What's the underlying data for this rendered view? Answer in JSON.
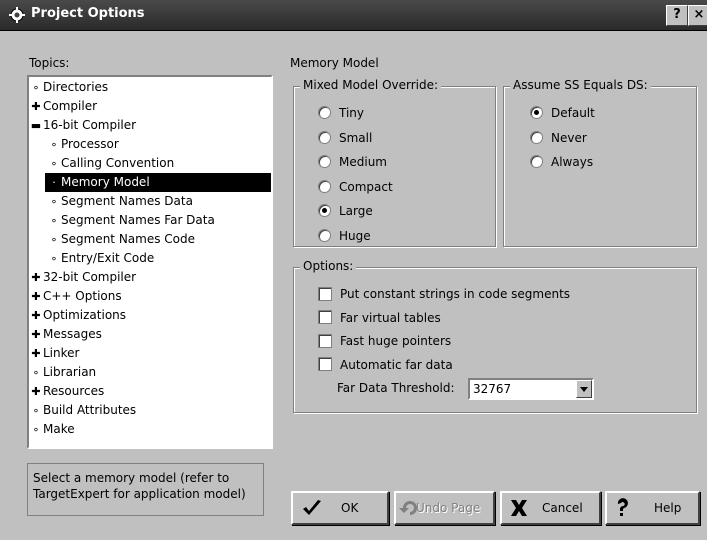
{
  "window": {
    "title": "Project Options",
    "help_button": "?",
    "close_button": "×"
  },
  "topics": {
    "label": "Topics:",
    "items": [
      {
        "glyph": "∘",
        "text": "Directories",
        "indent": 0
      },
      {
        "glyph": "✚",
        "text": "Compiler",
        "indent": 0
      },
      {
        "glyph": "▬",
        "text": "16-bit Compiler",
        "indent": 0
      },
      {
        "glyph": "∘",
        "text": "Processor",
        "indent": 1
      },
      {
        "glyph": "∘",
        "text": "Calling Convention",
        "indent": 1
      },
      {
        "glyph": "·",
        "text": "Memory Model",
        "indent": 1,
        "selected": true
      },
      {
        "glyph": "∘",
        "text": "Segment Names Data",
        "indent": 1
      },
      {
        "glyph": "∘",
        "text": "Segment Names Far Data",
        "indent": 1
      },
      {
        "glyph": "∘",
        "text": "Segment Names Code",
        "indent": 1
      },
      {
        "glyph": "∘",
        "text": "Entry/Exit Code",
        "indent": 1
      },
      {
        "glyph": "✚",
        "text": "32-bit Compiler",
        "indent": 0
      },
      {
        "glyph": "✚",
        "text": "C++ Options",
        "indent": 0
      },
      {
        "glyph": "✚",
        "text": "Optimizations",
        "indent": 0
      },
      {
        "glyph": "✚",
        "text": "Messages",
        "indent": 0
      },
      {
        "glyph": "✚",
        "text": "Linker",
        "indent": 0
      },
      {
        "glyph": "∘",
        "text": "Librarian",
        "indent": 0
      },
      {
        "glyph": "✚",
        "text": "Resources",
        "indent": 0
      },
      {
        "glyph": "∘",
        "text": "Build Attributes",
        "indent": 0
      },
      {
        "glyph": "∘",
        "text": "Make",
        "indent": 0
      }
    ]
  },
  "status_text": "Select a memory model (refer to TargetExpert for application model)",
  "panel": {
    "title": "Memory Model",
    "mixed_model": {
      "title": "Mixed Model Override:",
      "options": [
        "Tiny",
        "Small",
        "Medium",
        "Compact",
        "Large",
        "Huge"
      ],
      "selected": "Large"
    },
    "assume_ss": {
      "title": "Assume SS Equals DS:",
      "options": [
        "Default",
        "Never",
        "Always"
      ],
      "selected": "Default"
    },
    "options_group": {
      "title": "Options:",
      "checkboxes": [
        {
          "label": "Put constant strings in code segments",
          "checked": false
        },
        {
          "label": "Far virtual tables",
          "checked": false
        },
        {
          "label": "Fast huge pointers",
          "checked": false
        },
        {
          "label": "Automatic far data",
          "checked": false
        }
      ],
      "threshold_label": "Far Data Threshold:",
      "threshold_value": "32767"
    }
  },
  "buttons": {
    "ok": "OK",
    "undo": "Undo Page",
    "cancel": "Cancel",
    "help": "Help"
  }
}
